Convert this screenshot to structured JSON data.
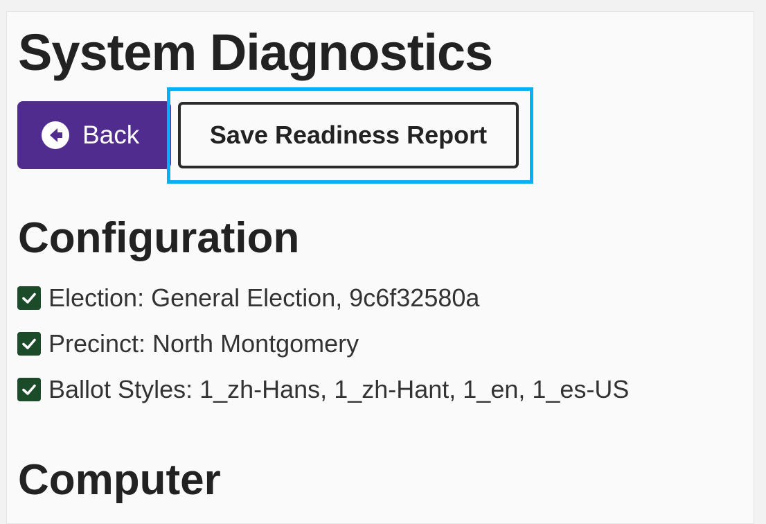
{
  "page": {
    "title": "System Diagnostics"
  },
  "toolbar": {
    "back_label": "Back",
    "back_icon": "circle-arrow-left-icon",
    "save_label": "Save Readiness Report"
  },
  "configuration": {
    "heading": "Configuration",
    "items": [
      {
        "label": "Election: General Election, 9c6f32580a",
        "status": "check"
      },
      {
        "label": "Precinct: North Montgomery",
        "status": "check"
      },
      {
        "label": "Ballot Styles: 1_zh-Hans, 1_zh-Hant, 1_en, 1_es-US",
        "status": "check"
      }
    ]
  },
  "computer": {
    "heading": "Computer"
  },
  "colors": {
    "back_button": "#512c8f",
    "focus_ring": "#05b1f2",
    "check_box": "#1c4b2a",
    "background": "#fafafa"
  }
}
